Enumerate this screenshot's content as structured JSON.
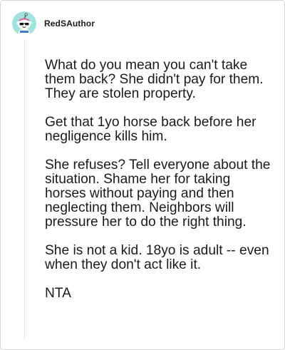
{
  "comment": {
    "author": "RedSAuthor",
    "avatar_icon": "snoo-avatar-sunglasses-icon",
    "paragraphs": [
      "What do you mean you can't take them back? She didn't pay for them. They are stolen property.",
      "Get that 1yo horse back before her negligence kills him.",
      "She refuses? Tell everyone about the situation. Shame her for taking horses without paying and then neglecting them. Neighbors will pressure her to do the right thing.",
      "She is not a kid. 18yo is adult -- even when they don't act like it.",
      "NTA"
    ]
  },
  "colors": {
    "border": "#d7d7d7",
    "thread_line": "#e2e2e2",
    "text": "#1a1a1a",
    "avatar_bg": "#9fe3e0"
  }
}
